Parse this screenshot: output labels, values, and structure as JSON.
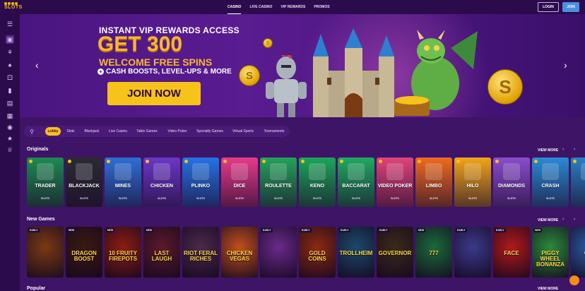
{
  "brand": {
    "logo_text": "SLOTS"
  },
  "topnav": {
    "links": [
      "CASINO",
      "LIVE CASINO",
      "VIP REWARDS",
      "PROMOS"
    ],
    "login_label": "LOGIN",
    "join_label": "JOIN"
  },
  "sidebar": {
    "icons": [
      "menu-icon",
      "chat-icon",
      "tree-icon",
      "spade-icon",
      "dice-icon",
      "card-icon",
      "ticket-icon",
      "grid-icon",
      "globe-icon",
      "star-icon",
      "crown-icon"
    ]
  },
  "hero": {
    "line1": "INSTANT VIP REWARDS ACCESS",
    "line2": "GET 300",
    "line3": "WELCOME FREE SPINS",
    "line4": "CASH BOOSTS, LEVEL-UPS & MORE",
    "cta": "JOIN NOW",
    "prev": "‹",
    "next": "›"
  },
  "filters": [
    "Lobby",
    "Slots",
    "Blackjack",
    "Live Casino",
    "Table Games",
    "Video Poker",
    "Specialty Games",
    "Virtual Sports",
    "Tournaments"
  ],
  "originals": {
    "title": "Originals",
    "view_more": "VIEW MORE",
    "brand": "SLOTS",
    "games": [
      {
        "name": "TRADER",
        "color": "#1e8a52"
      },
      {
        "name": "BLACKJACK",
        "color": "#2b2b33"
      },
      {
        "name": "MINES",
        "color": "#2d6fd6"
      },
      {
        "name": "CHICKEN",
        "color": "#6b37c9"
      },
      {
        "name": "PLINKO",
        "color": "#2573e6"
      },
      {
        "name": "DICE",
        "color": "#e63b8a"
      },
      {
        "name": "ROULETTE",
        "color": "#23a35a"
      },
      {
        "name": "KENO",
        "color": "#1ca55a"
      },
      {
        "name": "BACCARAT",
        "color": "#1faa61"
      },
      {
        "name": "VIDEO POKER",
        "color": "#e0447a"
      },
      {
        "name": "LIMBO",
        "color": "#f06a1f"
      },
      {
        "name": "HILO",
        "color": "#f2a51a"
      },
      {
        "name": "DIAMONDS",
        "color": "#8b4ccf"
      },
      {
        "name": "CRASH",
        "color": "#2b8ad6"
      },
      {
        "name": "WH",
        "color": "#2a7fc4"
      }
    ]
  },
  "new_games": {
    "title": "New Games",
    "view_more": "VIEW MORE",
    "games": [
      {
        "badge": "EARLY",
        "title": "",
        "color": "#7a3a12"
      },
      {
        "badge": "NEW",
        "title": "DRAGON BOOST",
        "color": "#3a1a10"
      },
      {
        "badge": "NEW",
        "title": "10 FRUITY FIREPOTS",
        "color": "#8a1d12"
      },
      {
        "badge": "NEW",
        "title": "LAST LAUGH",
        "color": "#5a1a2a"
      },
      {
        "badge": "",
        "title": "RIOT FERAL RICHES",
        "color": "#4a2a4a"
      },
      {
        "badge": "",
        "title": "CHICKEN VEGAS",
        "color": "#c0501a"
      },
      {
        "badge": "EARLY",
        "title": "",
        "color": "#6a2a8a"
      },
      {
        "badge": "EARLY",
        "title": "GOLD COINS",
        "color": "#8a2a12"
      },
      {
        "badge": "EARLY",
        "title": "TROLLHEIM",
        "color": "#1a4a6a"
      },
      {
        "badge": "EARLY",
        "title": "GOVERNOR",
        "color": "#3a2a1a"
      },
      {
        "badge": "NEW",
        "title": "777",
        "color": "#1a6a3a"
      },
      {
        "badge": "EARLY",
        "title": "",
        "color": "#3a3a8a"
      },
      {
        "badge": "EARLY",
        "title": "FACE",
        "color": "#b01a1a"
      },
      {
        "badge": "NEW",
        "title": "PIGGY WHEEL BONANZA",
        "color": "#2a8a3a"
      },
      {
        "badge": "",
        "title": "COI",
        "color": "#2a5aa0"
      }
    ]
  },
  "popular": {
    "title": "Popular",
    "view_more": "VIEW MORE"
  }
}
